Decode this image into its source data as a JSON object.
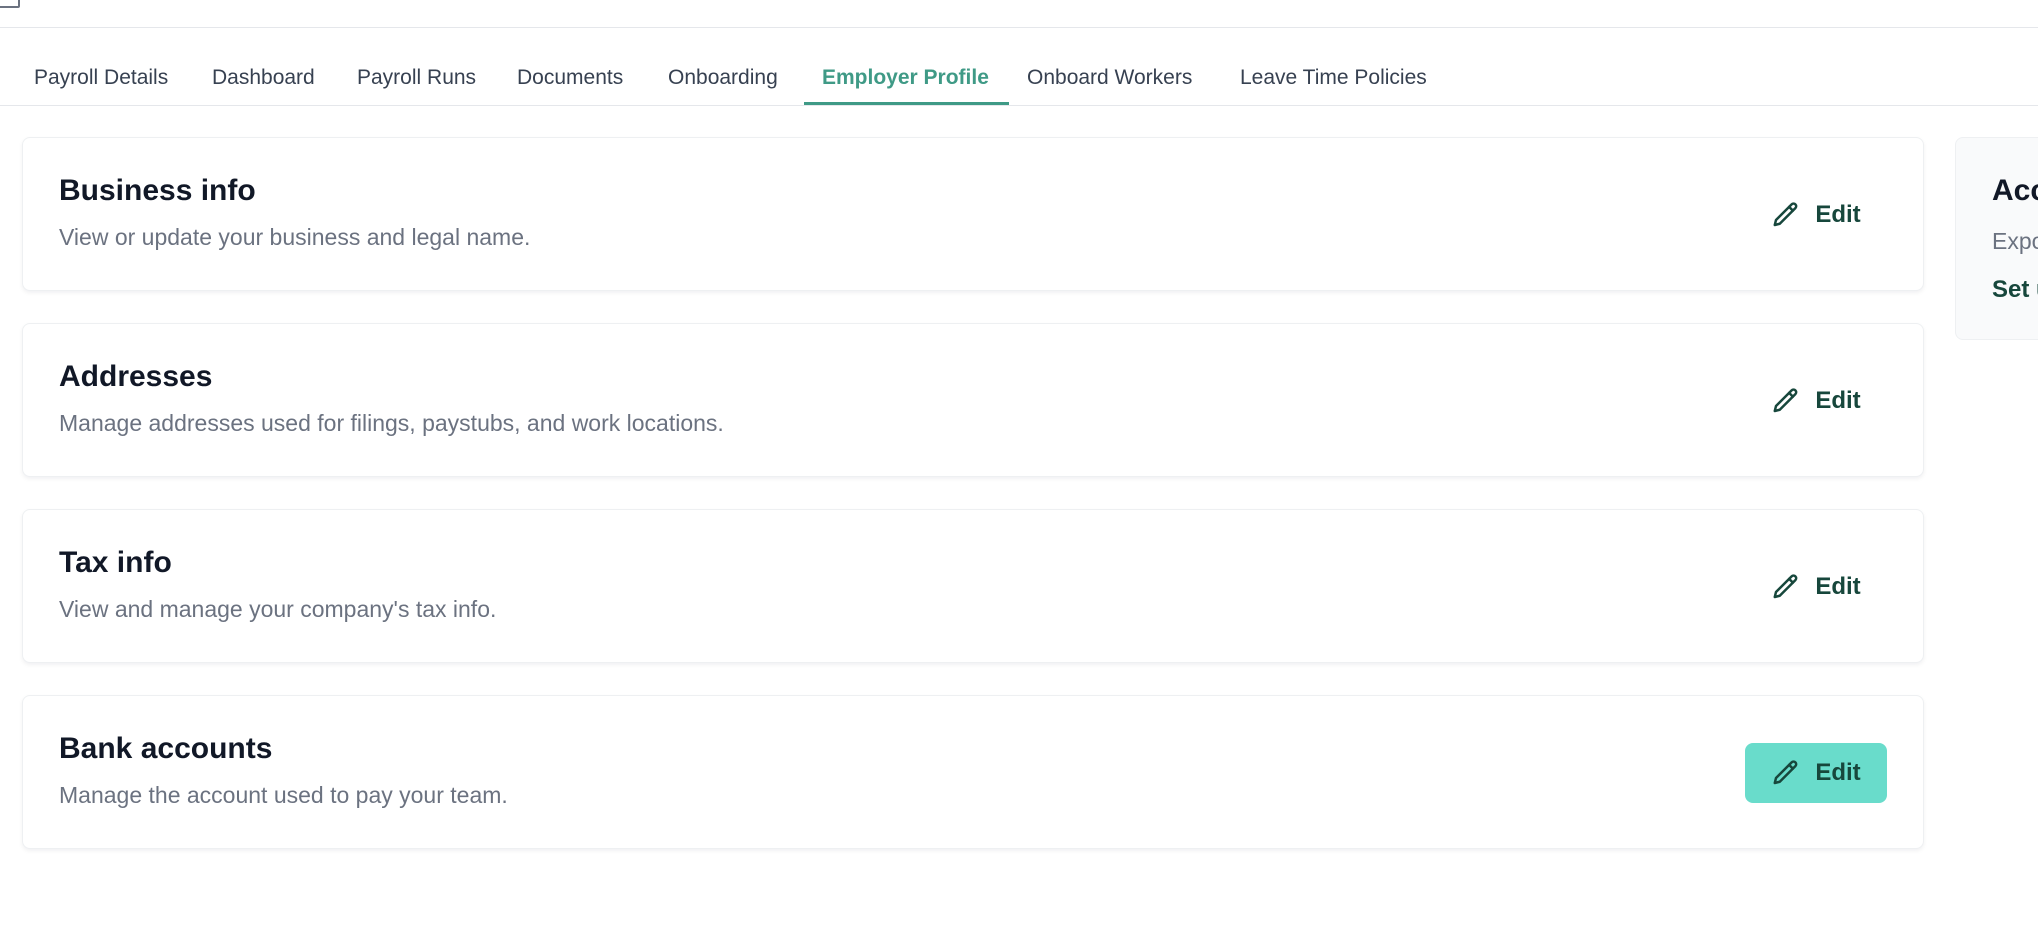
{
  "tabs": [
    {
      "label": "Payroll Details",
      "active": false
    },
    {
      "label": "Dashboard",
      "active": false
    },
    {
      "label": "Payroll Runs",
      "active": false
    },
    {
      "label": "Documents",
      "active": false
    },
    {
      "label": "Onboarding",
      "active": false
    },
    {
      "label": "Employer Profile",
      "active": true
    },
    {
      "label": "Onboard Workers",
      "active": false
    },
    {
      "label": "Leave Time Policies",
      "active": false
    }
  ],
  "sections": [
    {
      "title": "Business info",
      "description": "View or update your business and legal name.",
      "edit_label": "Edit",
      "edit_icon": "pencil-icon"
    },
    {
      "title": "Addresses",
      "description": "Manage addresses used for filings, paystubs, and work locations.",
      "edit_label": "Edit",
      "edit_icon": "pencil-icon"
    },
    {
      "title": "Tax info",
      "description": "View and manage your company's tax info.",
      "edit_label": "Edit",
      "edit_icon": "pencil-icon"
    },
    {
      "title": "Bank accounts",
      "description": "Manage the account used to pay your team.",
      "edit_label": "Edit",
      "edit_icon": "pencil-icon",
      "hovered": true
    }
  ],
  "side_card": {
    "title": "Acc",
    "description": "Expo",
    "link_label": "Set u"
  },
  "colors": {
    "accent": "#3f9a86",
    "edit_text": "#17473c",
    "edit_hover_bg": "#69dccb",
    "muted_text": "#6b7280"
  }
}
